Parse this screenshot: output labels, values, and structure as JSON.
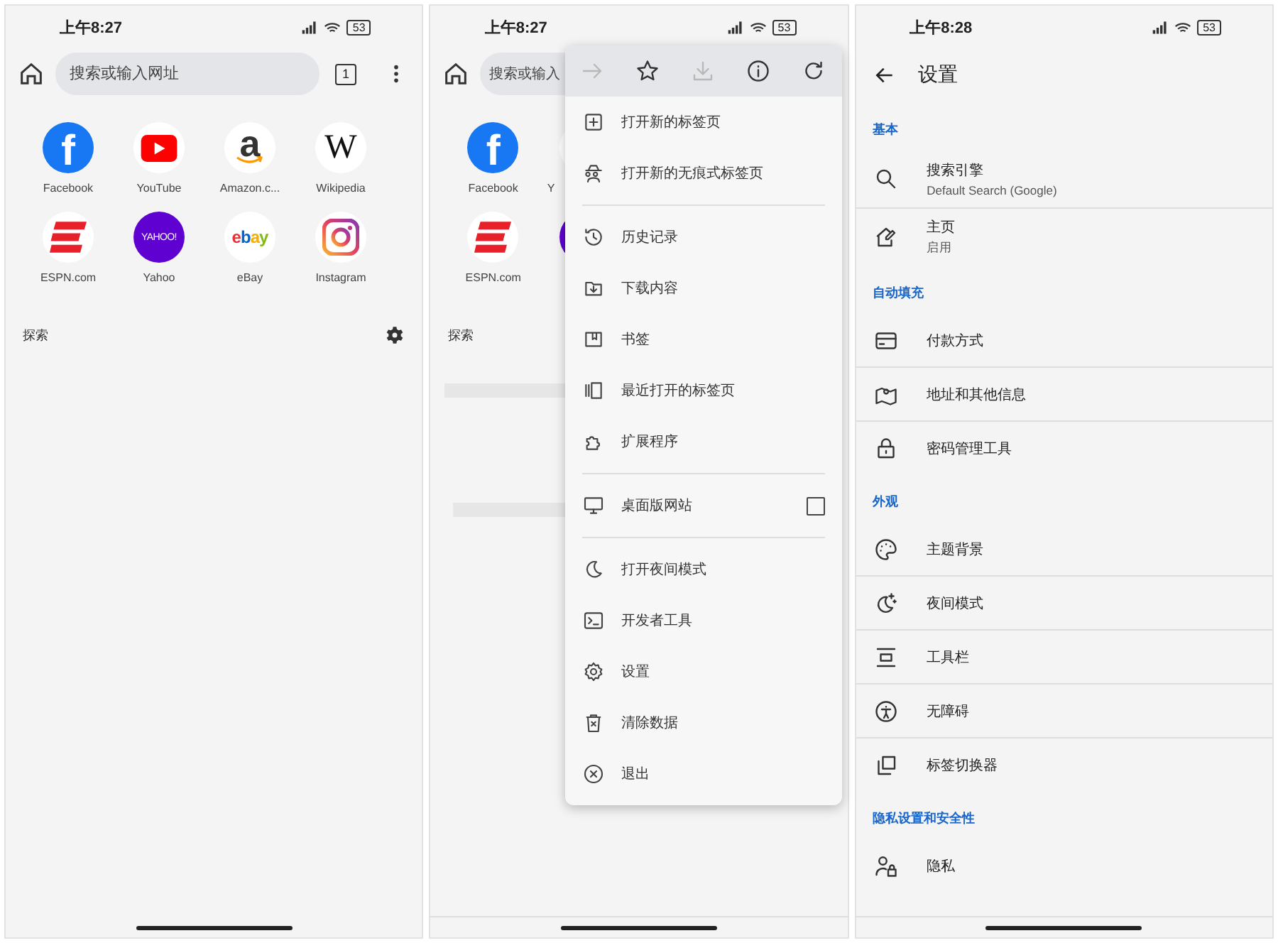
{
  "home_screen": {
    "status_bar": {
      "time": "上午8:27",
      "battery": "53"
    },
    "toolbar": {
      "search": {
        "placeholder": "搜索或输入网址"
      },
      "tab_count": "1"
    },
    "shortcuts": [
      {
        "label": "Facebook",
        "kind": "facebook",
        "logo_text": "f"
      },
      {
        "label": "YouTube",
        "kind": "youtube"
      },
      {
        "label": "Amazon.c...",
        "kind": "amazon",
        "logo_text": "a"
      },
      {
        "label": "Wikipedia",
        "kind": "wikipedia",
        "logo_text": "W"
      },
      {
        "label": "ESPN.com",
        "kind": "espn"
      },
      {
        "label": "Yahoo",
        "kind": "yahoo",
        "logo_text": "YAHOO!"
      },
      {
        "label": "eBay",
        "kind": "ebay",
        "logo_text": "ebay"
      },
      {
        "label": "Instagram",
        "kind": "instagram"
      }
    ],
    "discover": {
      "label": "探索"
    }
  },
  "menu_screen": {
    "status_bar": {
      "time": "上午8:27",
      "battery": "53"
    },
    "background": {
      "search": {
        "placeholder": "搜索或输入"
      },
      "shortcuts": [
        {
          "label": "Facebook",
          "kind": "facebook",
          "logo_text": "f"
        },
        {
          "label": "Y",
          "kind": "youtube"
        },
        {
          "label": "ESPN.com",
          "kind": "espn"
        },
        {
          "kind": "yahoo"
        }
      ],
      "discover": {
        "label": "探索"
      }
    },
    "menu": {
      "actions": [
        {
          "kind": "forward",
          "disabled": true
        },
        {
          "kind": "bookmark",
          "disabled": false
        },
        {
          "kind": "download",
          "disabled": true
        },
        {
          "kind": "info",
          "disabled": false
        },
        {
          "kind": "reload",
          "disabled": false
        }
      ],
      "items": [
        {
          "kind": "item",
          "label": "打开新的标签页"
        },
        {
          "kind": "item",
          "label": "打开新的无痕式标签页"
        },
        {
          "kind": "divider"
        },
        {
          "kind": "item",
          "label": "历史记录"
        },
        {
          "kind": "item",
          "label": "下载内容"
        },
        {
          "kind": "item",
          "label": "书签"
        },
        {
          "kind": "item",
          "label": "最近打开的标签页"
        },
        {
          "kind": "item",
          "label": "扩展程序"
        },
        {
          "kind": "divider"
        },
        {
          "kind": "checkbox",
          "label": "桌面版网站",
          "checked": false
        },
        {
          "kind": "divider"
        },
        {
          "kind": "item",
          "label": "打开夜间模式"
        },
        {
          "kind": "item",
          "label": "开发者工具"
        },
        {
          "kind": "item",
          "label": "设置"
        },
        {
          "kind": "item",
          "label": "清除数据"
        },
        {
          "kind": "item",
          "label": "退出"
        }
      ]
    }
  },
  "settings_screen": {
    "status_bar": {
      "time": "上午8:28",
      "battery": "53"
    },
    "title": "设置",
    "sections": [
      {
        "title": "基本",
        "items": [
          {
            "title": "搜索引擎",
            "subtitle": "Default Search (Google)"
          },
          {
            "title": "主页",
            "subtitle": "启用"
          }
        ]
      },
      {
        "title": "自动填充",
        "items": [
          {
            "title": "付款方式"
          },
          {
            "title": "地址和其他信息"
          },
          {
            "title": "密码管理工具"
          }
        ]
      },
      {
        "title": "外观",
        "items": [
          {
            "title": "主题背景"
          },
          {
            "title": "夜间模式"
          },
          {
            "title": "工具栏"
          },
          {
            "title": "无障碍"
          },
          {
            "title": "标签切换器"
          }
        ]
      },
      {
        "title": "隐私设置和安全性",
        "items": [
          {
            "title": "隐私"
          }
        ]
      }
    ]
  }
}
